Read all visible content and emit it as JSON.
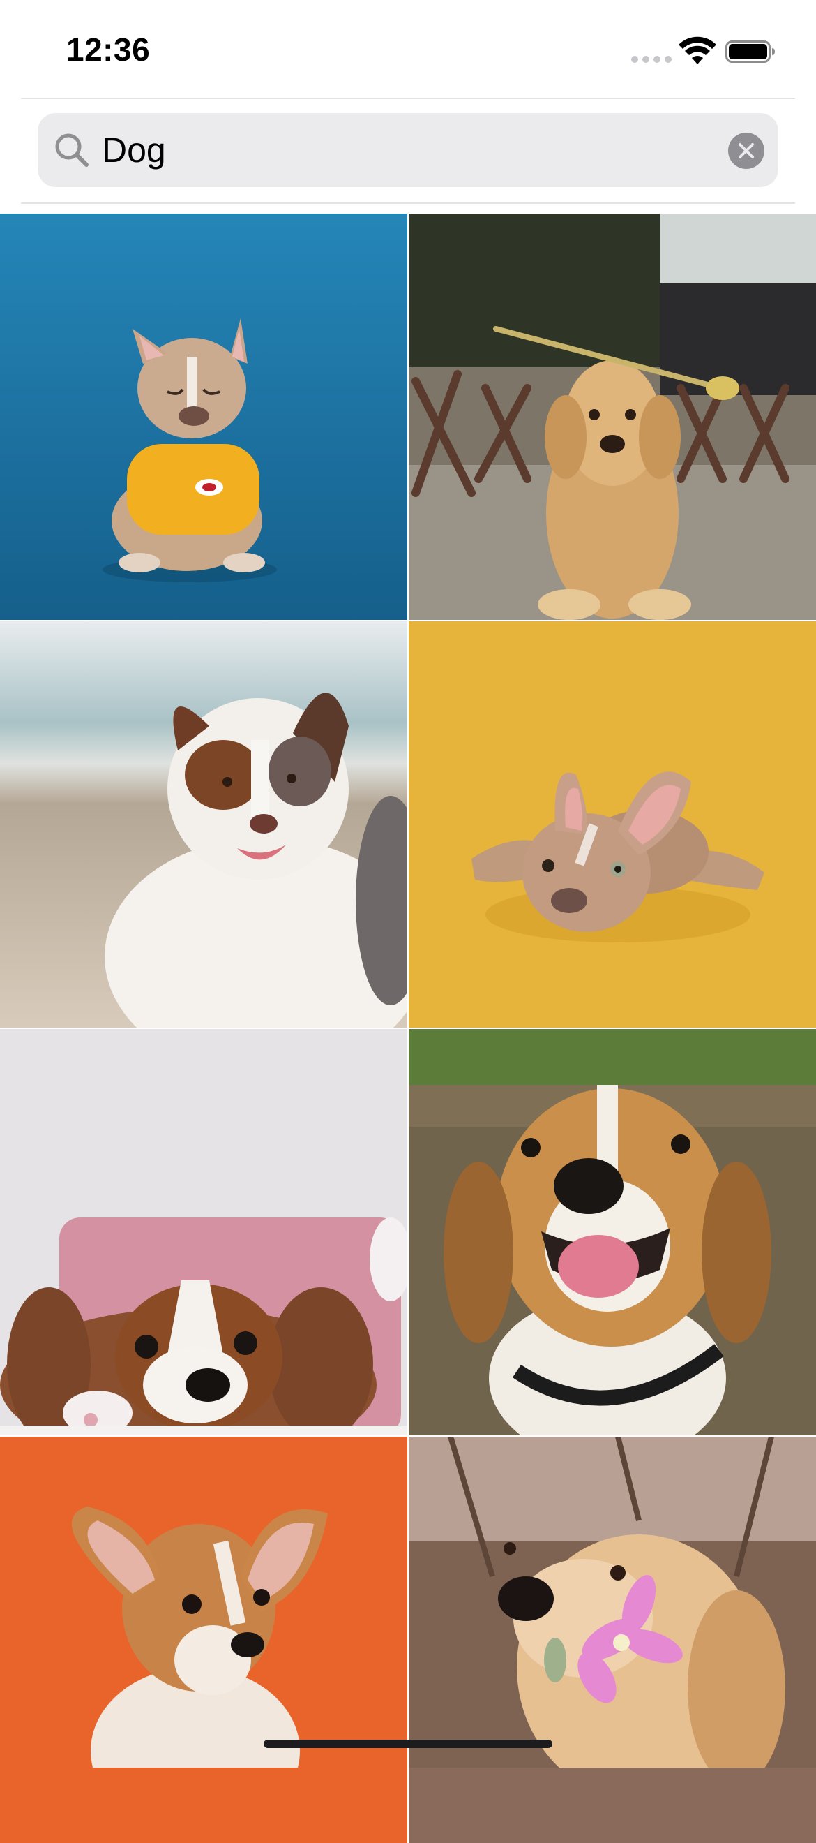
{
  "status_bar": {
    "time": "12:36",
    "signal_icon": "cellular-signal-icon",
    "wifi_icon": "wifi-icon",
    "battery_icon": "battery-full-icon"
  },
  "search": {
    "icon": "search-icon",
    "value": "Dog",
    "clear_icon": "clear-icon"
  },
  "results": [
    {
      "label": "french-bulldog-yellow-sweater-blue-backdrop",
      "background": "#1f7fb0"
    },
    {
      "label": "golden-puppy-holding-flower-stem",
      "background": "#8d8577"
    },
    {
      "label": "brown-white-dog-beach",
      "background": "#c9c0b2"
    },
    {
      "label": "french-bulldog-lying-yellow-backdrop",
      "background": "#e7b63c"
    },
    {
      "label": "cavalier-puppy-pink-pillow",
      "background": "#e4e2e5"
    },
    {
      "label": "beagle-smiling",
      "background": "#6b6049"
    },
    {
      "label": "corgi-puppy-orange-backdrop",
      "background": "#e8642b"
    },
    {
      "label": "golden-retriever-pink-flower",
      "background": "#8a6a5a"
    }
  ],
  "colors": {
    "search_bg": "#ebebed",
    "clear_bg": "#8e8e93"
  }
}
